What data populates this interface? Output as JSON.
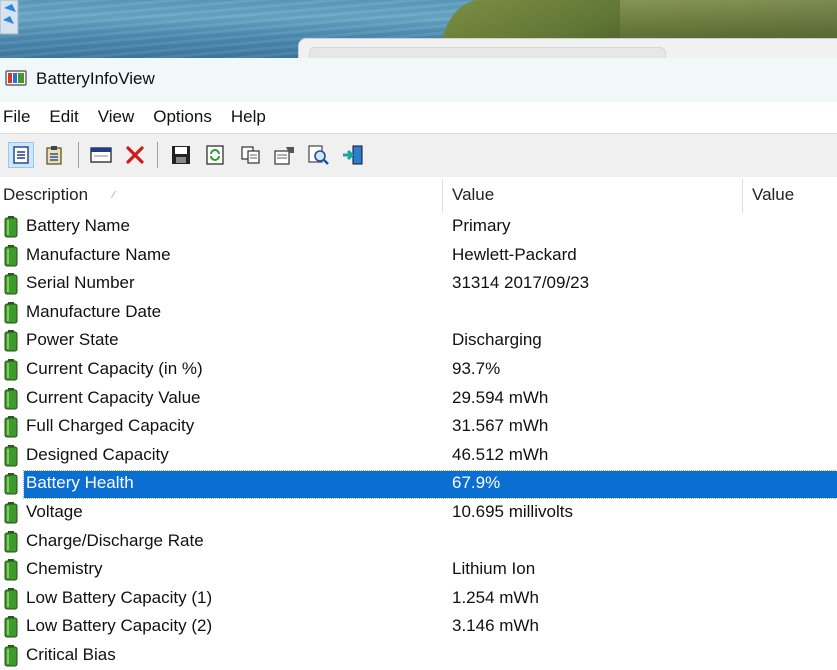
{
  "window": {
    "title": "BatteryInfoView"
  },
  "menu": [
    "File",
    "Edit",
    "View",
    "Options",
    "Help"
  ],
  "toolbar": {
    "buttons": [
      "properties-icon",
      "report-icon",
      "window-icon",
      "delete-icon",
      "save-icon",
      "refresh-icon",
      "copy-icon",
      "settings-icon",
      "find-icon",
      "exit-icon"
    ]
  },
  "columns": [
    "Description",
    "Value",
    "Value"
  ],
  "rows": [
    {
      "desc": "Battery Name",
      "value": "Primary"
    },
    {
      "desc": "Manufacture Name",
      "value": "Hewlett-Packard"
    },
    {
      "desc": "Serial Number",
      "value": "31314 2017/09/23"
    },
    {
      "desc": "Manufacture Date",
      "value": ""
    },
    {
      "desc": "Power State",
      "value": "Discharging"
    },
    {
      "desc": "Current Capacity (in %)",
      "value": "93.7%"
    },
    {
      "desc": "Current Capacity Value",
      "value": "29.594 mWh"
    },
    {
      "desc": "Full Charged Capacity",
      "value": "31.567 mWh"
    },
    {
      "desc": "Designed Capacity",
      "value": "46.512 mWh"
    },
    {
      "desc": "Battery Health",
      "value": "67.9%",
      "selected": true
    },
    {
      "desc": "Voltage",
      "value": "10.695 millivolts"
    },
    {
      "desc": "Charge/Discharge Rate",
      "value": ""
    },
    {
      "desc": "Chemistry",
      "value": "Lithium Ion"
    },
    {
      "desc": "Low Battery Capacity (1)",
      "value": "1.254 mWh"
    },
    {
      "desc": "Low Battery Capacity (2)",
      "value": "3.146 mWh"
    },
    {
      "desc": "Critical Bias",
      "value": ""
    }
  ],
  "colors": {
    "selection": "#0a6fd0",
    "battery_green": "#3f9a2e",
    "titlebar_bg": "#f0f8fa"
  }
}
